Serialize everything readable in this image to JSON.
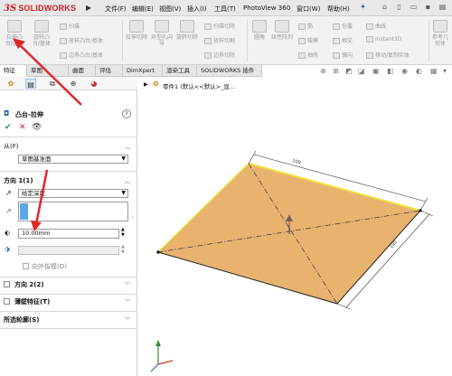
{
  "app": {
    "brand_ds": "3S",
    "brand_name": "SOLIDWORKS"
  },
  "menu": [
    "文件(F)",
    "编辑(E)",
    "视图(V)",
    "插入(I)",
    "工具(T)",
    "PhotoView 360",
    "窗口(W)",
    "帮助(H)"
  ],
  "ribbon": {
    "features": [
      {
        "name": "extrude-boss",
        "label": "拉伸凸台/基体"
      },
      {
        "name": "revolve-boss",
        "label": "旋转凸台/基体"
      },
      {
        "name": "extrude-cut",
        "label": "拉伸切除"
      },
      {
        "name": "hole-wizard",
        "label": "异型孔向导"
      },
      {
        "name": "revolve-cut",
        "label": "旋转切除"
      },
      {
        "name": "fillet",
        "label": "圆角"
      },
      {
        "name": "linear-pattern",
        "label": "线性阵列"
      },
      {
        "name": "reference-geometry",
        "label": "参考几何体"
      }
    ],
    "small": [
      {
        "name": "sweep",
        "label": "扫描"
      },
      {
        "name": "loft",
        "label": "放样凸台/基体"
      },
      {
        "name": "boundary-boss",
        "label": "边界凸台/基体"
      },
      {
        "name": "swept-cut",
        "label": "扫描切除"
      },
      {
        "name": "lofted-cut",
        "label": "放样切割"
      },
      {
        "name": "boundary-cut",
        "label": "边界切除"
      },
      {
        "name": "rib",
        "label": "筋"
      },
      {
        "name": "draft",
        "label": "拔模"
      },
      {
        "name": "shell",
        "label": "抽壳"
      },
      {
        "name": "wrap",
        "label": "包覆"
      },
      {
        "name": "intersect",
        "label": "相交"
      },
      {
        "name": "mirror",
        "label": "镜向"
      },
      {
        "name": "curves",
        "label": "曲线"
      },
      {
        "name": "instant3d",
        "label": "Instant3D"
      },
      {
        "name": "move-copy",
        "label": "移动/复制实体"
      }
    ]
  },
  "tabs": [
    "特征",
    "草图",
    "曲面",
    "评估",
    "DimXpert",
    "渲染工具",
    "SOLIDWORKS 插件"
  ],
  "tree": {
    "part_label": "零件1 (默认<<默认>_显..."
  },
  "property_manager": {
    "title": "凸台-拉伸",
    "help": "?",
    "from_label": "从(F)",
    "from_value": "草图基准面",
    "dir1_label": "方向 1(1)",
    "end_condition": "给定深度",
    "depth": "10.00mm",
    "draft_outward": "向外拔模(O)",
    "dir2_label": "方向 2(2)",
    "thin_feature": "薄壁特征(T)",
    "selected_contours": "所选轮廓(S)"
  },
  "dimensions": {
    "top": "100",
    "right": "100"
  },
  "colors": {
    "face": "#e8b36f",
    "edge": "#f0dd3a",
    "accent": "#d32027"
  }
}
